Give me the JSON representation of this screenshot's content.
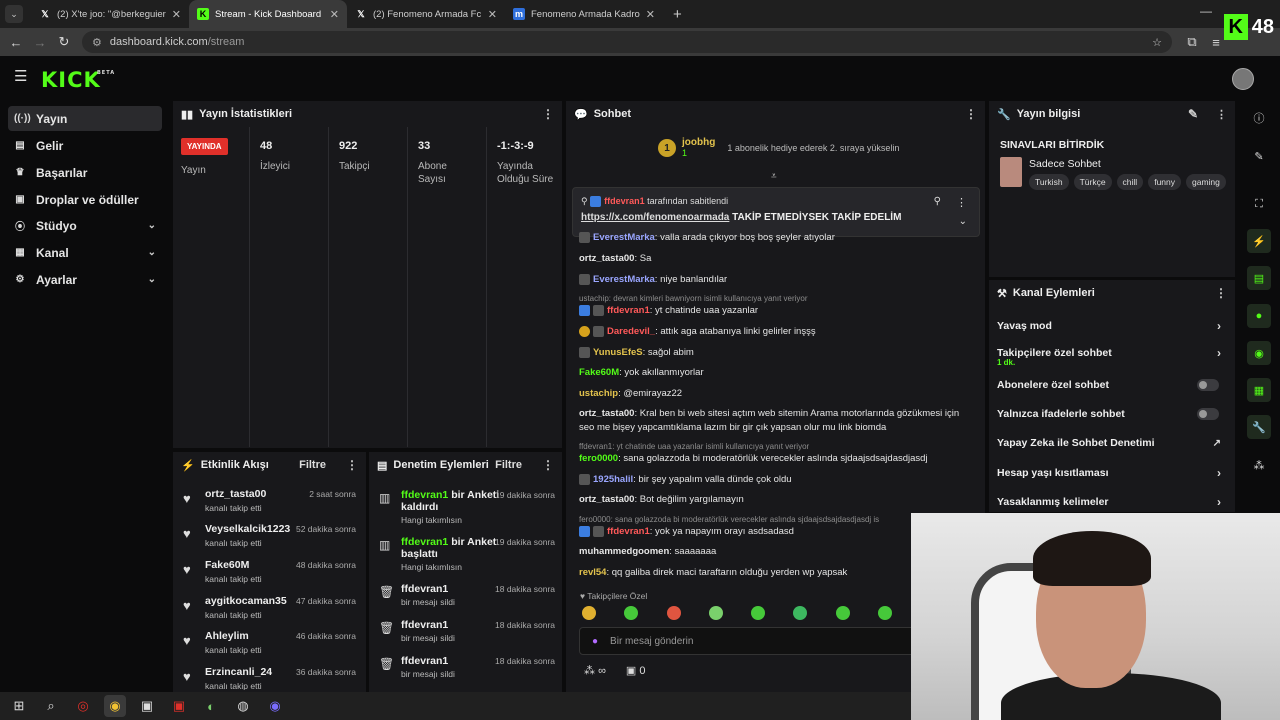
{
  "browser": {
    "tabs": [
      {
        "title": "(2) X'te joo: \"@berkeguierr yine",
        "icon": "x-icon",
        "active": false
      },
      {
        "title": "Stream - Kick Dashboard",
        "icon": "kick-icon",
        "active": true
      },
      {
        "title": "(2) Fenomeno Armada Fc (@fe",
        "icon": "x-icon",
        "active": false
      },
      {
        "title": "Fenomeno Armada Kadro | Mac",
        "icon": "m-icon",
        "active": false
      }
    ],
    "url_host": "dashboard.kick.com",
    "url_path": "/stream"
  },
  "overlay": {
    "viewer_count": "48"
  },
  "app": {
    "logo": "KICK",
    "logo_sup": "BETA"
  },
  "sidebar": {
    "items": [
      {
        "label": "Yayın",
        "icon": "broadcast-icon",
        "active": true
      },
      {
        "label": "Gelir",
        "icon": "revenue-icon",
        "active": false
      },
      {
        "label": "Başarılar",
        "icon": "trophy-icon",
        "active": false
      },
      {
        "label": "Droplar ve ödüller",
        "icon": "gift-icon",
        "active": false
      },
      {
        "label": "Stüdyo",
        "icon": "studio-icon",
        "active": false,
        "expandable": true
      },
      {
        "label": "Kanal",
        "icon": "channel-icon",
        "active": false,
        "expandable": true
      },
      {
        "label": "Ayarlar",
        "icon": "gear-icon",
        "active": false,
        "expandable": true
      }
    ]
  },
  "stats": {
    "title": "Yayın İstatistikleri",
    "live_label": "YAYINDA",
    "live_sub": "Yayın",
    "viewers": "48",
    "viewers_label": "İzleyici",
    "followers": "922",
    "followers_label": "Takipçi",
    "subs": "33",
    "subs_label": "Abone Sayısı",
    "uptime": "-1:-3:-9",
    "uptime_label": "Yayında Olduğu Süre"
  },
  "feed": {
    "title": "Etkinlik Akışı",
    "filter": "Filtre",
    "items": [
      {
        "name": "ortz_tasta00",
        "action": "kanalı takip etti",
        "time": "2 saat sonra"
      },
      {
        "name": "Veyselkalcik1223",
        "action": "kanalı takip etti",
        "time": "52 dakika sonra"
      },
      {
        "name": "Fake60M",
        "action": "kanalı takip etti",
        "time": "48 dakika sonra"
      },
      {
        "name": "aygitkocaman35",
        "action": "kanalı takip etti",
        "time": "47 dakika sonra"
      },
      {
        "name": "Ahleylim",
        "action": "kanalı takip etti",
        "time": "46 dakika sonra"
      },
      {
        "name": "Erzincanli_24",
        "action": "kanalı takip etti",
        "time": "36 dakika sonra"
      }
    ]
  },
  "mods": {
    "title": "Denetim Eylemleri",
    "filter": "Filtre",
    "items": [
      {
        "user": "ffdevran1",
        "action": "bir Anketi kaldırdı",
        "sub": "Hangi takımlısın",
        "time": "19 dakika sonra"
      },
      {
        "user": "ffdevran1",
        "action": "bir Anket başlattı",
        "sub": "Hangi takımlısın",
        "time": "19 dakika sonra"
      },
      {
        "user": "ffdevran1",
        "action": "",
        "sub": "bir mesajı sildi",
        "time": "18 dakika sonra"
      },
      {
        "user": "ffdevran1",
        "action": "",
        "sub": "bir mesajı sildi",
        "time": "18 dakika sonra"
      },
      {
        "user": "ffdevran1",
        "action": "",
        "sub": "bir mesajı sildi",
        "time": "18 dakika sonra"
      }
    ]
  },
  "chat": {
    "title": "Sohbet",
    "top_user": "joobhg",
    "top_user_level": "1",
    "top_msg": "1 abonelik hediye ederek 2. sıraya yükselin",
    "pinned_by": "ffdevran1",
    "pinned_by_suffix": "tarafından sabitlendi",
    "pinned_link": "https://x.com/fenomenoarmada",
    "pinned_text": "TAKİP ETMEDİYSEK TAKİP EDELİM",
    "messages": [
      {
        "user": "EverestMarka",
        "color": "#9aa6ff",
        "text": "valla arada çıkıyor boş boş şeyler atıyolar"
      },
      {
        "user": "ortz_tasta00",
        "color": "#e6e6e6",
        "text": "Sa"
      },
      {
        "user": "EverestMarka",
        "color": "#9aa6ff",
        "text": "niye banlandılar"
      },
      {
        "reply": "ustachip: devran kimleri bawniyorn isimli kullanıcıya yanıt veriyor"
      },
      {
        "user": "ffdevran1",
        "color": "#ff5959",
        "text": "yt chatinde uaa yazanlar"
      },
      {
        "user": "Daredevil_",
        "color": "#ff5959",
        "text": "attık aga atabanıya linki gelirler inşşş"
      },
      {
        "user": "YunusEfeS",
        "color": "#e3c34d",
        "text": "sağol abim"
      },
      {
        "user": "Fake60M",
        "color": "#53fc18",
        "text": "yok akıllanmıyorlar"
      },
      {
        "user": "ustachip",
        "color": "#e3c34d",
        "text": "@emirayaz22"
      },
      {
        "user": "ortz_tasta00",
        "color": "#e6e6e6",
        "text": "Kral ben bi web sitesi açtım web sitemin Arama motorlarında gözükmesi için seo me bişey yapcamtıklama lazım bir gir çık yapsan olur mu link biomda"
      },
      {
        "reply": "ffdevran1: yt chatinde uaa yazanlar isimli kullanıcıya yanıt veriyor"
      },
      {
        "user": "fero0000",
        "color": "#53fc18",
        "text": "sana golazzoda bi moderatörlük verecekler aslında sjdaajsdsajdasdjasdj"
      },
      {
        "user": "1925halil",
        "color": "#9aa6ff",
        "text": "bir şey yapalım valla dünde çok oldu"
      },
      {
        "user": "ortz_tasta00",
        "color": "#e6e6e6",
        "text": "Bot değilim yargılamayın"
      },
      {
        "reply": "fero0000: sana golazzoda bi moderatörlük verecekler aslında sjdaajsdsajdasdjasdj is"
      },
      {
        "user": "ffdevran1",
        "color": "#ff5959",
        "text": "yok ya napayım orayı asdsadasd"
      },
      {
        "user": "muhammedgoomen",
        "color": "#e6e6e6",
        "text": "saaaaaaa"
      },
      {
        "user": "revl54",
        "color": "#e3c34d",
        "text": "qq galiba direk maci taraftarın olduğu yerden wp yapsak"
      }
    ],
    "followers_only": "Takipçilere Özel",
    "input_placeholder": "Bir mesaj gönderin",
    "infinity": "∞",
    "gift_count": "0"
  },
  "info": {
    "title": "Yayın bilgisi",
    "stream_title": "SINAVLARI BİTİRDİK",
    "category": "Sadece Sohbet",
    "tags": [
      "Turkish",
      "Türkçe",
      "chill",
      "funny",
      "gaming"
    ]
  },
  "actions": {
    "title": "Kanal Eylemleri",
    "slow_mode": "Yavaş mod",
    "followers_chat": "Takipçilere özel sohbet",
    "followers_chat_sub": "1 dk.",
    "subs_chat": "Abonelere özel sohbet",
    "emotes_chat": "Yalnızca ifadelerle sohbet",
    "ai_mod": "Yapay Zeka ile Sohbet Denetimi",
    "account_age": "Hesap yaşı kısıtlaması",
    "banned_words": "Yasaklanmış kelimeler"
  }
}
